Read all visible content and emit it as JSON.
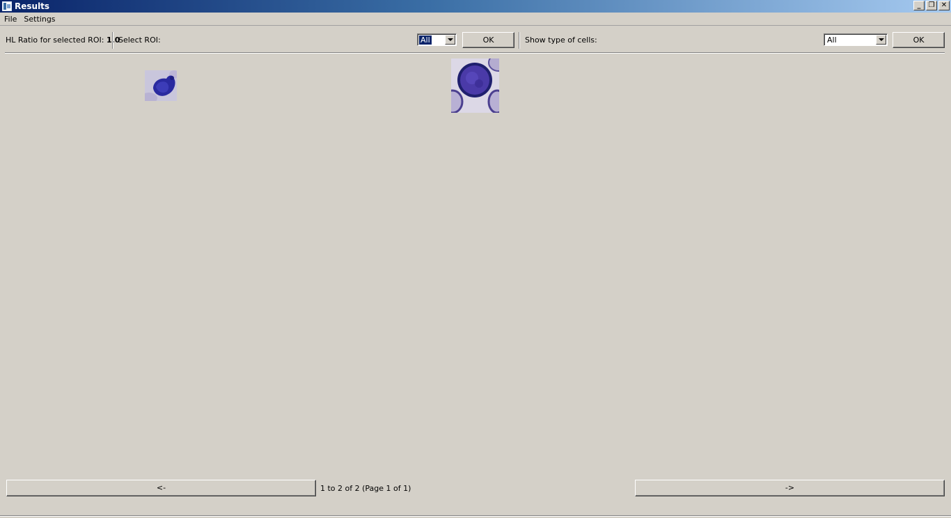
{
  "window": {
    "title": "Results",
    "controls": [
      "minimize",
      "restore",
      "close"
    ]
  },
  "menu": {
    "items": [
      "File",
      "Settings"
    ]
  },
  "toolbar": {
    "hl_ratio_label": "HL Ratio for selected ROI:",
    "hl_ratio_value": "1.0",
    "select_roi_label": "Select ROI:",
    "roi_select_value": "All",
    "roi_ok_label": "OK",
    "cell_type_label": "Show type of cells:",
    "cell_type_select_value": "All",
    "cell_type_ok_label": "OK"
  },
  "cells": [
    {
      "name": "cell-thumbnail-1",
      "type": "small purple-stained cell"
    },
    {
      "name": "cell-thumbnail-2",
      "type": "round purple-stained cell with surrounding red cells"
    }
  ],
  "pagination": {
    "prev_label": "<-",
    "next_label": "->",
    "info": "1 to 2 of 2 (Page 1 of 1)"
  },
  "colors": {
    "titlebar_start": "#0a246a",
    "titlebar_end": "#a6caf0",
    "background": "#d4d0c8",
    "selection": "#0a246a"
  }
}
